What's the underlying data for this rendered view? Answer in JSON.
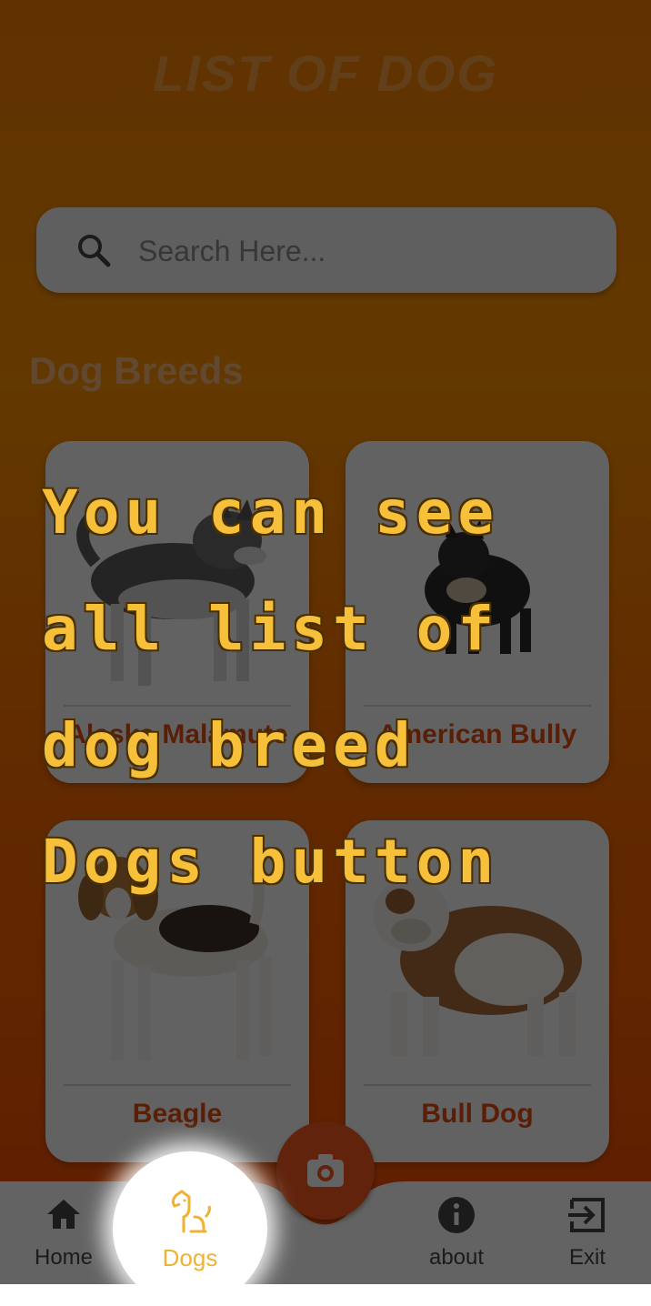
{
  "header": {
    "title": "LIST OF DOG"
  },
  "search": {
    "placeholder": "Search Here...",
    "icon": "search-icon"
  },
  "section": {
    "title": "Dog Breeds"
  },
  "breeds": [
    {
      "name": "Alaska Malamute"
    },
    {
      "name": "American Bully"
    },
    {
      "name": "Beagle"
    },
    {
      "name": "Bull Dog"
    }
  ],
  "nav": {
    "items": [
      {
        "label": "Home",
        "icon": "home-icon"
      },
      {
        "label": "Dogs",
        "icon": "dog-icon"
      },
      {
        "label": "about",
        "icon": "info-icon"
      },
      {
        "label": "Exit",
        "icon": "exit-icon"
      }
    ],
    "camera_icon": "camera-icon"
  },
  "tooltip": {
    "text": "You can see all list of dog breed Dogs button"
  },
  "colors": {
    "accent": "#f2581f",
    "highlight": "#f0b234",
    "tooltip_text": "#f7c03a"
  }
}
